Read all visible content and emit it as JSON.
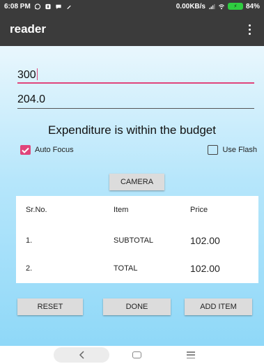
{
  "status_bar": {
    "time": "6:08 PM",
    "network_speed": "0.00KB/s",
    "battery_level": "84%",
    "icons": [
      "whatsapp-icon",
      "notification-icon",
      "chat-icon",
      "edit-icon",
      "signal-icon",
      "wifi-icon",
      "battery-charging-icon"
    ]
  },
  "app_bar": {
    "title": "reader",
    "menu_icon": "overflow-menu-icon"
  },
  "fields": {
    "budget_value": "300",
    "expense_value": "204.0"
  },
  "message": "Expenditure is within the budget",
  "checkboxes": {
    "auto_focus": {
      "label": "Auto Focus",
      "checked": true
    },
    "use_flash": {
      "label": "Use Flash",
      "checked": false
    }
  },
  "camera_button": {
    "label": "CAMERA"
  },
  "table": {
    "headers": [
      "Sr.No.",
      "Item",
      "Price"
    ],
    "rows": [
      {
        "sr": "1.",
        "item": "SUBTOTAL",
        "price": "102.00"
      },
      {
        "sr": "2.",
        "item": "TOTAL",
        "price": "102.00"
      }
    ]
  },
  "buttons": {
    "reset": "RESET",
    "done": "DONE",
    "add_item": "ADD ITEM"
  },
  "colors": {
    "app_bar": "#3b3b3b",
    "accent": "#e0457b",
    "background_gradient_top": "#e9f7fd",
    "background_gradient_bottom": "#8fd8f8"
  },
  "nav_bar": {
    "icons": [
      "back-icon",
      "home-icon",
      "recents-icon"
    ]
  }
}
